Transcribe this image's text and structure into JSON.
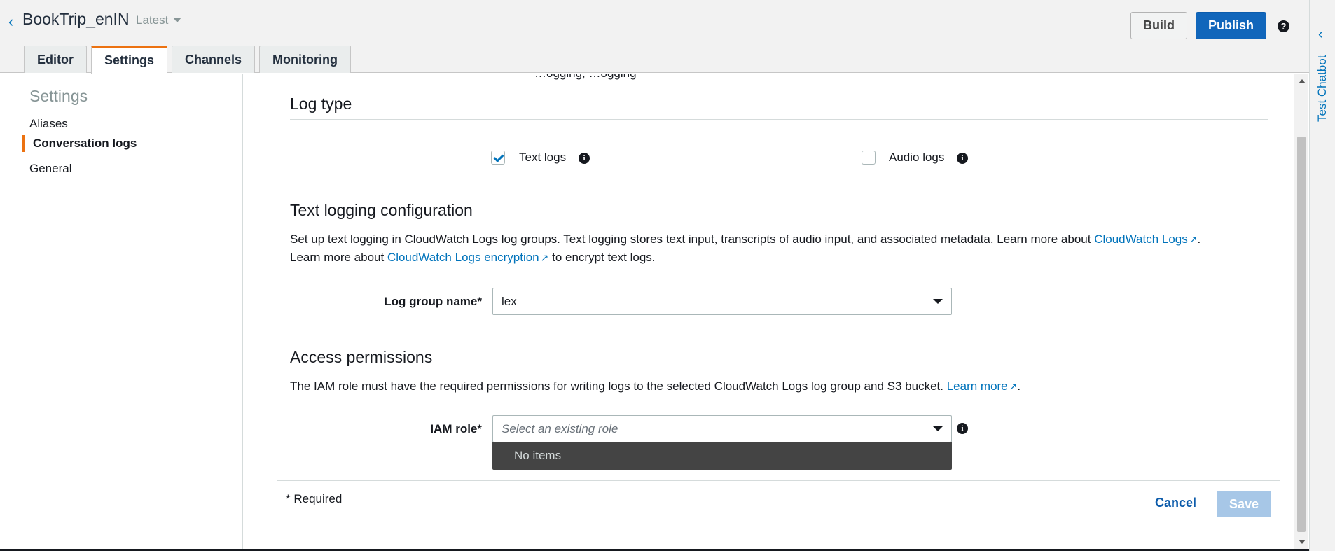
{
  "header": {
    "bot_name": "BookTrip_enIN",
    "version": "Latest",
    "build_label": "Build",
    "publish_label": "Publish",
    "help_glyph": "?"
  },
  "tabs": [
    {
      "label": "Editor"
    },
    {
      "label": "Settings"
    },
    {
      "label": "Channels"
    },
    {
      "label": "Monitoring"
    }
  ],
  "sidebar": {
    "title": "Settings",
    "items": [
      {
        "label": "Aliases"
      },
      {
        "label": "Conversation logs"
      },
      {
        "label": "General"
      }
    ]
  },
  "main": {
    "clipped_text": "…ogging, …ogging",
    "log_type": {
      "heading": "Log type",
      "text_logs_label": "Text logs",
      "text_logs_checked": true,
      "audio_logs_label": "Audio logs",
      "audio_logs_checked": false
    },
    "text_logging": {
      "heading": "Text logging configuration",
      "desc_1": "Set up text logging in CloudWatch Logs log groups. Text logging stores text input, transcripts of audio input, and associated metadata. Learn more about ",
      "link_1": "CloudWatch Logs",
      "desc_1_end": ".",
      "desc_2": "Learn more about ",
      "link_2": "CloudWatch Logs encryption",
      "desc_2_end": " to encrypt text logs.",
      "log_group_label": "Log group name*",
      "log_group_value": "lex"
    },
    "access": {
      "heading": "Access permissions",
      "desc": "The IAM role must have the required permissions for writing logs to the selected CloudWatch Logs log group and S3 bucket. ",
      "link": "Learn more",
      "desc_end": ".",
      "iam_label": "IAM role*",
      "iam_placeholder": "Select an existing role",
      "dropdown_empty": "No items"
    },
    "footer": {
      "required_note": "* Required",
      "cancel_label": "Cancel",
      "save_label": "Save"
    }
  },
  "rail": {
    "label": "Test Chatbot"
  },
  "colors": {
    "accent_orange": "#ec7211",
    "link_blue": "#0073bb",
    "primary_button": "#1166bb",
    "disabled_save": "#a7c7e7"
  }
}
